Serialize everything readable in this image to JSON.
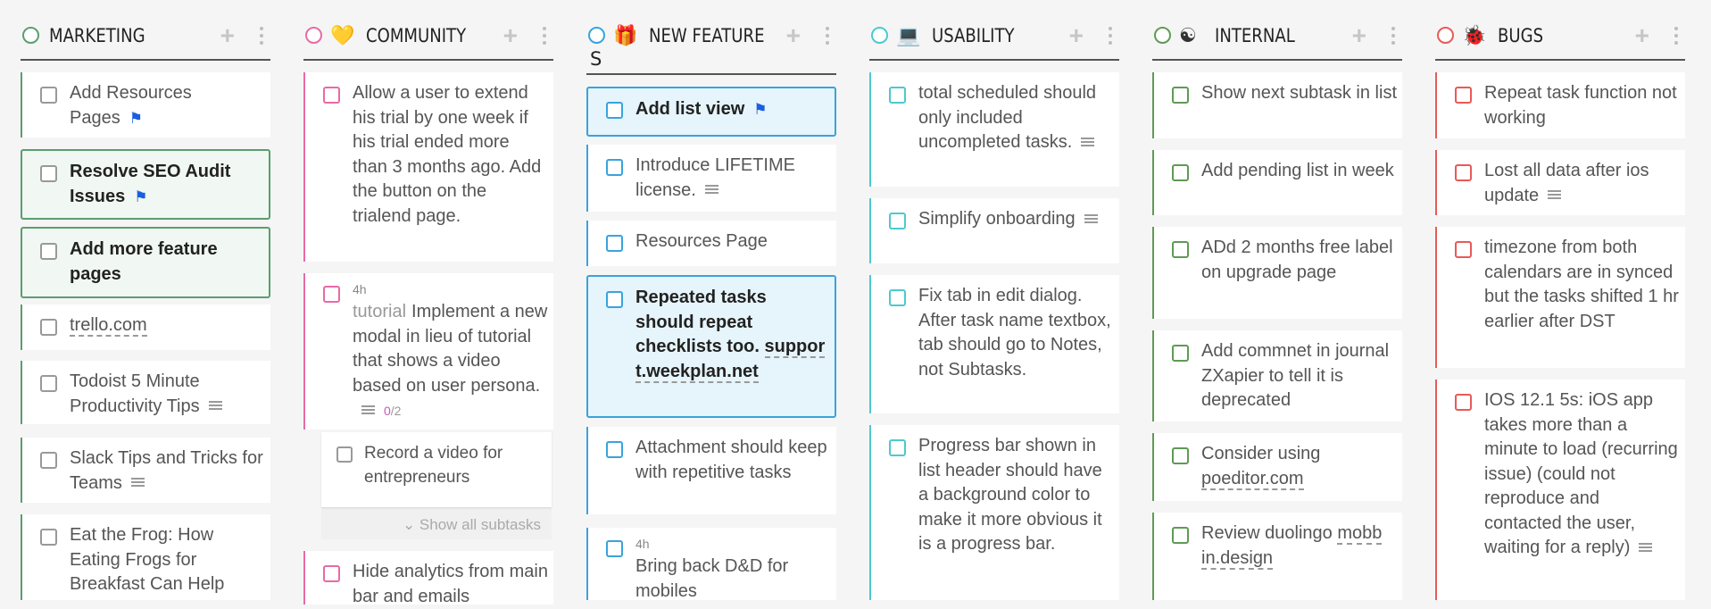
{
  "columns": [
    {
      "title": "MARKETING",
      "emoji": "",
      "color": "#5a9e6f",
      "cards": [
        {
          "text": "Add Resources Pages",
          "flag": true
        },
        {
          "text": "Resolve SEO Audit Issues",
          "flag": true,
          "bold": true
        },
        {
          "text": "Add more feature pages",
          "bold": true
        },
        {
          "link": "trello.com"
        },
        {
          "text": "Todoist 5 Minute Productivity Tips",
          "notes": true
        },
        {
          "text": "Slack Tips and Tricks for Teams",
          "notes": true
        },
        {
          "text": "Eat the Frog: How Eating Frogs for Breakfast Can Help"
        }
      ]
    },
    {
      "title": "COMMUNITY",
      "emoji": "💛",
      "color": "#e86aa6",
      "cards": [
        {
          "text": "Allow a user to extend his trial by one week if his trial ended more than 3 months ago. Add the button on the trialend page."
        },
        {
          "duration": "4h",
          "tag": "tutorial",
          "text": "Implement a new modal in lieu of tutorial that shows a video based on user persona.",
          "notes": true,
          "count_done": "0",
          "count_total": "/2"
        },
        {
          "text": "Hide analytics from main bar and emails"
        }
      ],
      "subtask": {
        "text": "Record a video for entrepreneurs"
      },
      "show_all": "⌄ Show all subtasks"
    },
    {
      "title": "NEW FEATURE",
      "title_wrap": "S",
      "emoji": "🎁",
      "color": "#39a3dd",
      "cards": [
        {
          "text": "Add list view",
          "flag": true,
          "bold": true
        },
        {
          "text": "Introduce LIFETIME license.",
          "notes": true
        },
        {
          "text": "Resources Page"
        },
        {
          "text": "Repeated tasks should repeat checklists too.",
          "link": "support.weekplan.net",
          "bold": true
        },
        {
          "text": "Attachment should keep with repetitive tasks"
        },
        {
          "duration": "4h",
          "text": "Bring back D&D for mobiles",
          "red": true
        }
      ]
    },
    {
      "title": "USABILITY",
      "emoji": "💻",
      "color": "#4cc9cf",
      "cards": [
        {
          "text": "total scheduled should only included uncompleted tasks.",
          "notes": true
        },
        {
          "text": "Simplify onboarding",
          "notes": true
        },
        {
          "text": "Fix tab in edit dialog. After task name textbox, tab should go to Notes, not Subtasks."
        },
        {
          "text": "Progress bar shown in list header should have a background color to make it more obvious it is a progress bar."
        }
      ]
    },
    {
      "title": "INTERNAL",
      "emoji": "☯",
      "color": "#5f9a55",
      "cards": [
        {
          "text": "Show next subtask in list"
        },
        {
          "text": "Add pending list in week"
        },
        {
          "text": "ADd 2 months free label on upgrade page"
        },
        {
          "text": "Add commnet in journal ZXapier to tell it is deprecated"
        },
        {
          "text": "Consider using",
          "link": "poeditor.com"
        },
        {
          "text": "Review duolingo",
          "link": "mobbin.design"
        }
      ]
    },
    {
      "title": "BUGS",
      "emoji": "🐞",
      "color": "#e85a57",
      "cards": [
        {
          "text": "Repeat task function not working"
        },
        {
          "text": "Lost all data after ios update",
          "notes": true
        },
        {
          "text": "timezone from both calendars are in synced but the tasks shifted 1 hr earlier after DST"
        },
        {
          "text": "IOS 12.1 5s: iOS app takes more than a minute to load (recurring issue) (could not reproduce and contacted the user, waiting for a reply)",
          "notes": true
        }
      ]
    }
  ]
}
